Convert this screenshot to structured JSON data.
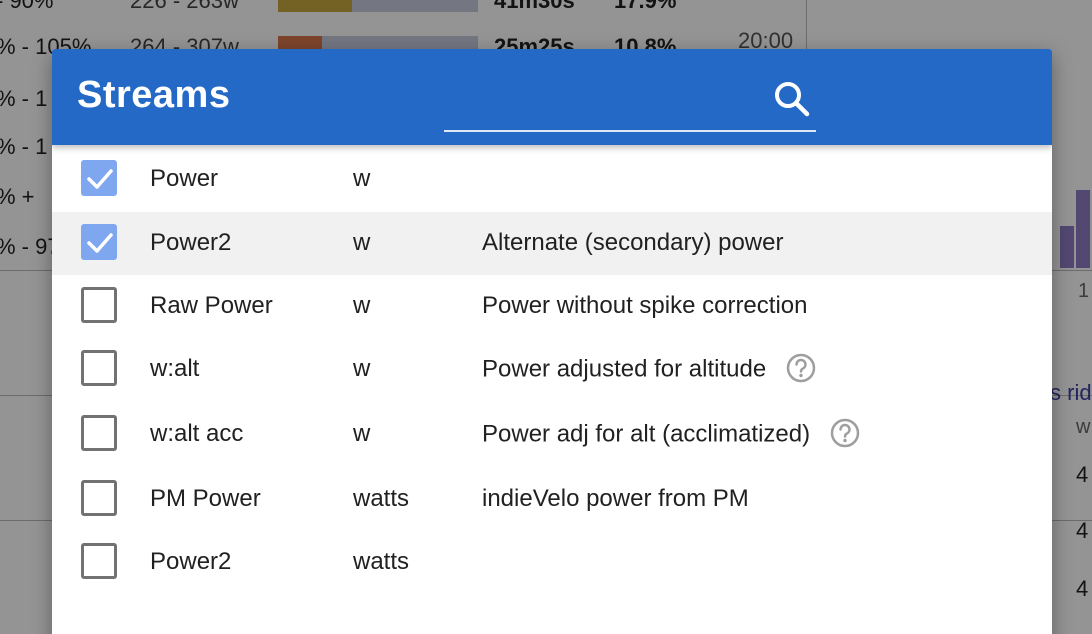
{
  "background": {
    "rows": [
      {
        "pct": "- 90%",
        "watts": "226 - 263w",
        "fill_color": "#c9a93f",
        "fill_fraction": 0.37,
        "time": "41m30s",
        "share": "17.9%"
      },
      {
        "pct": "% - 105%",
        "watts": "264 - 307w",
        "fill_color": "#d8764a",
        "fill_fraction": 0.22,
        "time": "25m25s",
        "share": "10.8%"
      },
      {
        "pct": "% - 1",
        "watts": "",
        "fill_color": "",
        "fill_fraction": 0,
        "time": "",
        "share": ""
      },
      {
        "pct": "% - 1",
        "watts": "",
        "fill_color": "",
        "fill_fraction": 0,
        "time": "",
        "share": ""
      },
      {
        "pct": "% +",
        "watts": "",
        "fill_color": "",
        "fill_fraction": 0,
        "time": "",
        "share": ""
      },
      {
        "pct": "% - 97",
        "watts": "",
        "fill_color": "",
        "fill_fraction": 0,
        "time": "",
        "share": ""
      }
    ],
    "axis_label": "20:00",
    "link_text": "s rid",
    "unit": "w",
    "one": "1",
    "numbers": [
      "4",
      "4",
      "4"
    ]
  },
  "dialog": {
    "title": "Streams",
    "search": {
      "placeholder": "",
      "value": ""
    },
    "accent_color": "#2469c6",
    "checked_color": "#7fa7ef",
    "streams": [
      {
        "name": "Power",
        "unit": "w",
        "description": "",
        "checked": true,
        "help": false
      },
      {
        "name": "Power2",
        "unit": "w",
        "description": "Alternate (secondary) power",
        "checked": true,
        "help": false
      },
      {
        "name": "Raw Power",
        "unit": "w",
        "description": "Power without spike correction",
        "checked": false,
        "help": false
      },
      {
        "name": "w:alt",
        "unit": "w",
        "description": "Power adjusted for altitude",
        "checked": false,
        "help": true
      },
      {
        "name": "w:alt acc",
        "unit": "w",
        "description": "Power adj for alt (acclimatized)",
        "checked": false,
        "help": true
      },
      {
        "name": "PM Power",
        "unit": "watts",
        "description": "indieVelo power from PM",
        "checked": false,
        "help": false
      },
      {
        "name": "Power2",
        "unit": "watts",
        "description": "",
        "checked": false,
        "help": false
      }
    ]
  }
}
